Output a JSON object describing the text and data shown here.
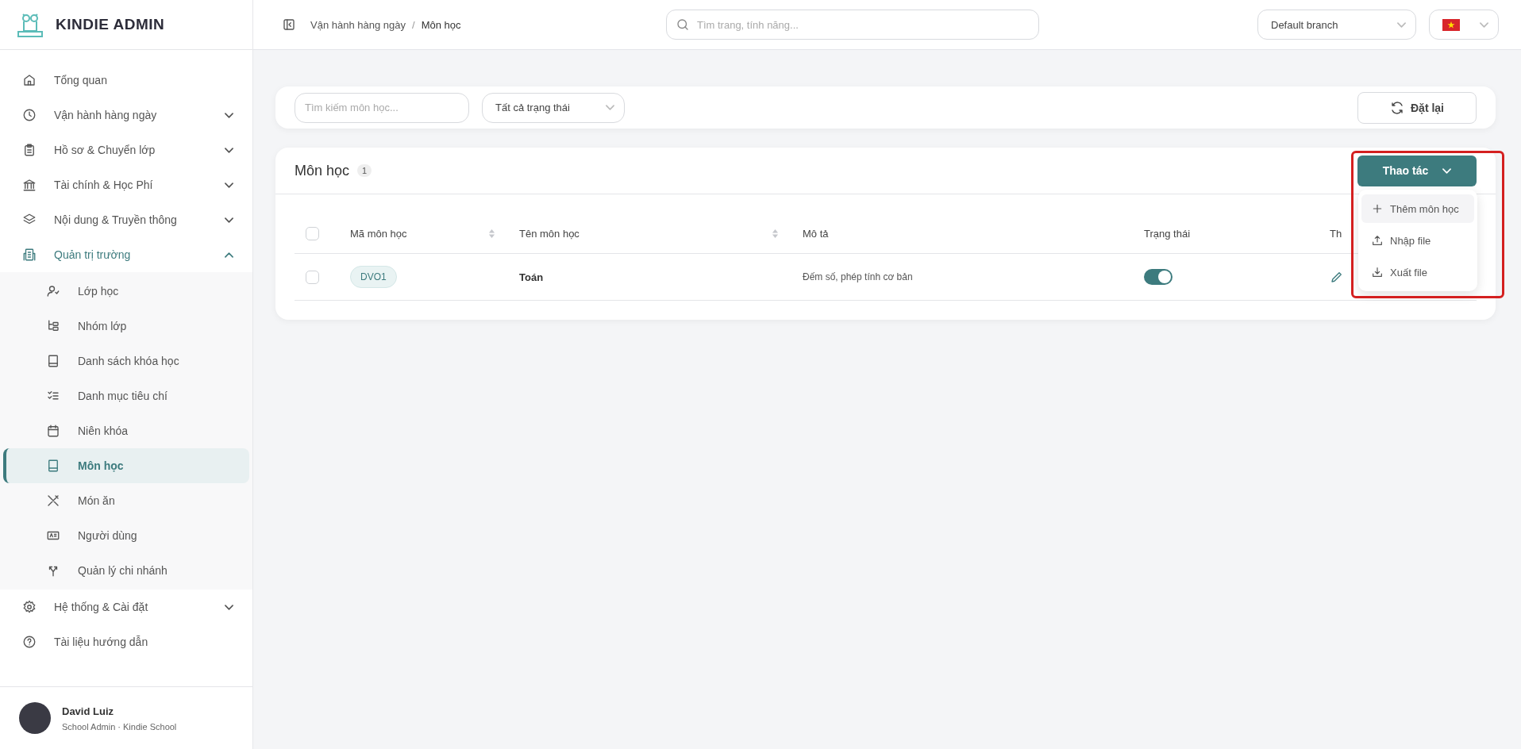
{
  "sidebar": {
    "brand": "KINDIE ADMIN",
    "items": [
      {
        "label": "Tổng quan",
        "kind": "link"
      },
      {
        "label": "Vận hành hàng ngày",
        "kind": "group",
        "expanded": false
      },
      {
        "label": "Hồ sơ & Chuyển lớp",
        "kind": "group",
        "expanded": false
      },
      {
        "label": "Tài chính & Học Phí",
        "kind": "group",
        "expanded": false
      },
      {
        "label": "Nội dung & Truyền thông",
        "kind": "group",
        "expanded": false
      },
      {
        "label": "Quản trị trường",
        "kind": "group",
        "expanded": true,
        "children": [
          {
            "label": "Lớp học",
            "selected": false
          },
          {
            "label": "Nhóm lớp",
            "selected": false
          },
          {
            "label": "Danh sách khóa học",
            "selected": false
          },
          {
            "label": "Danh mục tiêu chí",
            "selected": false
          },
          {
            "label": "Niên khóa",
            "selected": false
          },
          {
            "label": "Môn học",
            "selected": true
          },
          {
            "label": "Món ăn",
            "selected": false
          },
          {
            "label": "Người dùng",
            "selected": false
          },
          {
            "label": "Quản lý chi nhánh",
            "selected": false
          }
        ]
      },
      {
        "label": "Hệ thống & Cài đặt",
        "kind": "group",
        "expanded": false
      },
      {
        "label": "Tài liệu hướng dẫn",
        "kind": "link"
      }
    ],
    "user": {
      "name": "David Luiz",
      "role": "School Admin · Kindie School"
    }
  },
  "topbar": {
    "breadcrumb": [
      "Vận hành hàng ngày",
      "Môn học"
    ],
    "separator": "/",
    "search": {
      "placeholder": "Tìm trang, tính năng..."
    },
    "branch": "Default branch"
  },
  "filters": {
    "search": {
      "placeholder": "Tìm kiếm môn học..."
    },
    "status": "Tất cả trạng thái",
    "reset": "Đặt lại"
  },
  "table": {
    "title": "Môn học",
    "count": "1",
    "actions": {
      "label": "Thao tác",
      "expanded": true,
      "items": [
        {
          "label": "Thêm môn học",
          "kind": "add",
          "selected": true
        },
        {
          "label": "Nhập file",
          "kind": "import",
          "selected": false
        },
        {
          "label": "Xuất file",
          "kind": "export",
          "selected": false
        }
      ]
    },
    "select_all_checked": false,
    "columns": [
      {
        "label": "Mã môn học",
        "sortable": true
      },
      {
        "label": "Tên môn học",
        "sortable": true
      },
      {
        "label": "Mô tả",
        "sortable": false
      },
      {
        "label": "Trạng thái",
        "sortable": false
      },
      {
        "label": "Th",
        "sortable": false
      }
    ],
    "rows": [
      {
        "checked": false,
        "code": "DVO1",
        "name": "Toán",
        "description": "Đếm số, phép tính cơ bản",
        "active": true
      }
    ]
  }
}
